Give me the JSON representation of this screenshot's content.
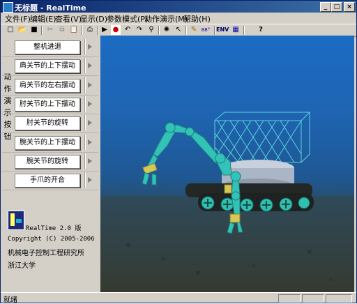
{
  "window": {
    "title": "无标题 - RealTime"
  },
  "titlebar_buttons": [
    {
      "name": "minimize-button",
      "glyph": "_"
    },
    {
      "name": "maximize-button",
      "glyph": "□"
    },
    {
      "name": "close-button",
      "glyph": "×"
    }
  ],
  "menu": [
    "文件(F)",
    "编辑(E)",
    "查看(V)",
    "显示(D)",
    "参数模式(P)",
    "动作演示(M)",
    "帮助(H)"
  ],
  "toolbar": {
    "items": [
      {
        "name": "new-icon",
        "glyph": "□"
      },
      {
        "name": "open-icon",
        "glyph": "📂"
      },
      {
        "name": "save-icon",
        "glyph": "■"
      },
      {
        "name": "cut-icon",
        "glyph": "✂"
      },
      {
        "name": "copy-icon",
        "glyph": "⧉"
      },
      {
        "name": "paste-icon",
        "glyph": "📋"
      },
      {
        "name": "print-icon",
        "glyph": "⎙"
      },
      {
        "name": "play-icon",
        "glyph": "▶"
      },
      {
        "name": "stop-icon",
        "glyph": "●"
      },
      {
        "name": "rotate-left-icon",
        "glyph": "↶"
      },
      {
        "name": "rotate-right-icon",
        "glyph": "↷"
      },
      {
        "name": "zoom-icon",
        "glyph": "⚲"
      },
      {
        "name": "light-icon",
        "glyph": "✺"
      },
      {
        "name": "pointer-icon",
        "glyph": "↖"
      },
      {
        "name": "pencil-icon",
        "glyph": "✎"
      },
      {
        "name": "reset-text",
        "glyph": "88°"
      },
      {
        "name": "env-text",
        "glyph": "ENV"
      },
      {
        "name": "grid-icon",
        "glyph": "▦"
      },
      {
        "name": "help-icon",
        "glyph": "?"
      }
    ]
  },
  "sidebar": {
    "vertical_label": [
      "动",
      "作",
      "演",
      "示",
      "按",
      "钮"
    ],
    "actions": [
      "整机进退",
      "肩关节的上下摆动",
      "肩关节的左右摆动",
      "肘关节的上下摆动",
      "肘关节的旋转",
      "腕关节的上下摆动",
      "腕关节的旋转",
      "手爪的开合"
    ],
    "info": [
      "RealTime 2.0 版",
      "Copyright (C) 2005-2006",
      "机械电子控制工程研究所",
      "浙江大学"
    ]
  },
  "status": {
    "text": "就绪"
  },
  "colors": {
    "title_bar": "#0a246a",
    "face": "#d4d0c8",
    "water": "#1e64b2",
    "robot": "#33c2b8"
  }
}
